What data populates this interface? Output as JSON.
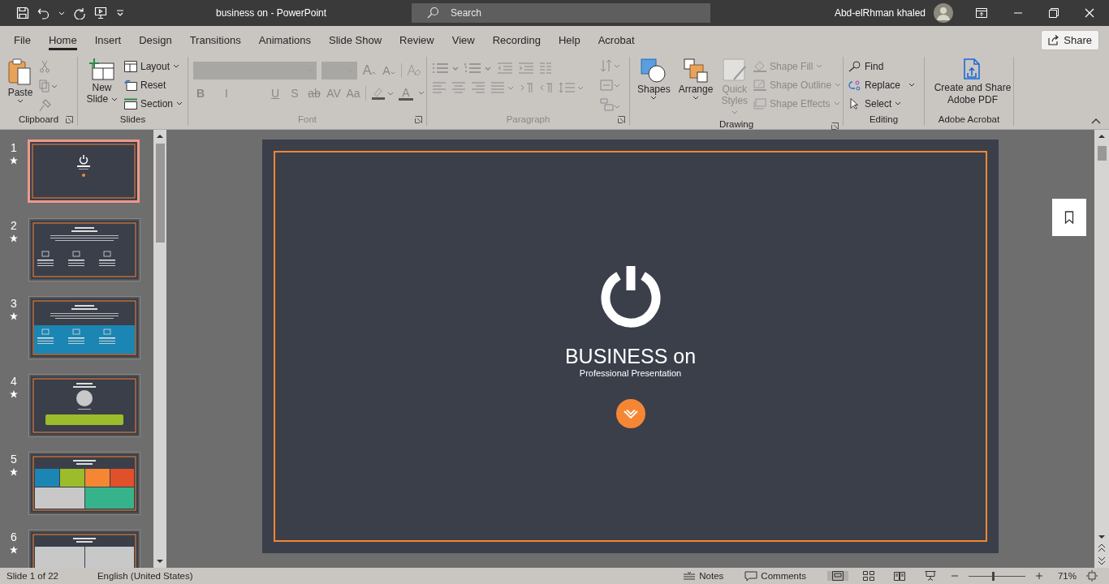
{
  "window": {
    "title": "business on  -  PowerPoint",
    "user": "Abd-elRhman khaled"
  },
  "search": {
    "placeholder": "Search"
  },
  "tabs": [
    {
      "label": "File",
      "selected": false
    },
    {
      "label": "Home",
      "selected": true
    },
    {
      "label": "Insert",
      "selected": false
    },
    {
      "label": "Design",
      "selected": false
    },
    {
      "label": "Transitions",
      "selected": false
    },
    {
      "label": "Animations",
      "selected": false
    },
    {
      "label": "Slide Show",
      "selected": false
    },
    {
      "label": "Review",
      "selected": false
    },
    {
      "label": "View",
      "selected": false
    },
    {
      "label": "Recording",
      "selected": false
    },
    {
      "label": "Help",
      "selected": false
    },
    {
      "label": "Acrobat",
      "selected": false
    }
  ],
  "share": "Share",
  "ribbon": {
    "clipboard": {
      "label": "Clipboard",
      "paste": "Paste"
    },
    "slides": {
      "label": "Slides",
      "new_slide": "New Slide",
      "layout": "Layout",
      "reset": "Reset",
      "section": "Section"
    },
    "font": {
      "label": "Font",
      "disabled": true,
      "grow": "A",
      "shrink": "A",
      "styles": [
        "B",
        "I",
        "U",
        "S",
        "ab",
        "AV",
        "Aa"
      ],
      "font_color": "A"
    },
    "paragraph": {
      "label": "Paragraph",
      "disabled": true
    },
    "drawing": {
      "label": "Drawing",
      "shapes": {
        "label": "Shapes",
        "disabled": false
      },
      "arrange": {
        "label": "Arrange",
        "disabled": false
      },
      "quick_styles": {
        "label": "Quick Styles",
        "disabled": true
      },
      "shape_fill": {
        "label": "Shape Fill",
        "disabled": true
      },
      "shape_outline": {
        "label": "Shape Outline",
        "disabled": true
      },
      "shape_effects": {
        "label": "Shape Effects",
        "disabled": true
      }
    },
    "editing": {
      "label": "Editing",
      "find": "Find",
      "replace": "Replace",
      "select": "Select"
    },
    "acrobat": {
      "label": "Adobe Acrobat",
      "create": "Create and Share Adobe PDF"
    }
  },
  "slides": [
    {
      "number": "1",
      "animated": true,
      "selected": true,
      "kind": "title"
    },
    {
      "number": "2",
      "animated": true,
      "selected": false,
      "kind": "features"
    },
    {
      "number": "3",
      "animated": true,
      "selected": false,
      "kind": "features-band"
    },
    {
      "number": "4",
      "animated": true,
      "selected": false,
      "kind": "welcome"
    },
    {
      "number": "5",
      "animated": true,
      "selected": false,
      "kind": "boxes"
    },
    {
      "number": "6",
      "animated": true,
      "selected": false,
      "kind": "panels"
    }
  ],
  "slide": {
    "title": "BUSINESS on",
    "subtitle": "Professional Presentation"
  },
  "status_bar": {
    "slide": "Slide 1 of 22",
    "language": "English (United States)",
    "notes": "Notes",
    "comments": "Comments",
    "zoom": "71%",
    "zoom_slider": {
      "level": 0.42
    }
  }
}
